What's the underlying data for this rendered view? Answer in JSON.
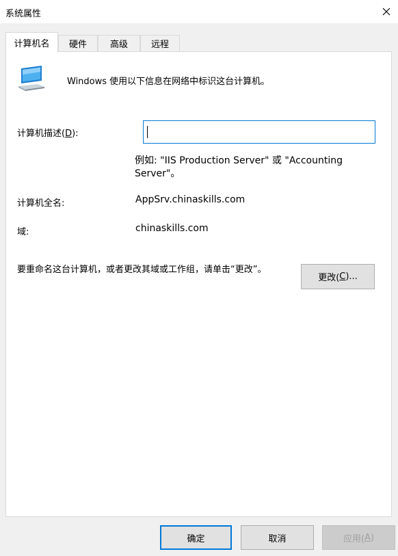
{
  "window": {
    "title": "系统属性"
  },
  "tabs": [
    {
      "label": "计算机名"
    },
    {
      "label": "硬件"
    },
    {
      "label": "高级"
    },
    {
      "label": "远程"
    }
  ],
  "content": {
    "intro": "Windows 使用以下信息在网络中标识这台计算机。",
    "desc_label_pre": "计算机描述(",
    "desc_label_key": "D",
    "desc_label_post": "):",
    "desc_value": "",
    "example": "例如: \"IIS Production Server\" 或 \"Accounting Server\"。",
    "fullname_label": "计算机全名:",
    "fullname_value": "AppSrv.chinaskills.com",
    "domain_label": "域:",
    "domain_value": "chinaskills.com",
    "rename_text": "要重命名这台计算机，或者更改其域或工作组，请单击“更改”。",
    "change_pre": "更改(",
    "change_key": "C",
    "change_post": ")..."
  },
  "buttons": {
    "ok": "确定",
    "cancel": "取消",
    "apply_pre": "应用(",
    "apply_key": "A",
    "apply_post": ")"
  },
  "icons": {
    "close": "close-icon",
    "computer": "computer-icon"
  },
  "colors": {
    "focus_border": "#0078d7"
  }
}
